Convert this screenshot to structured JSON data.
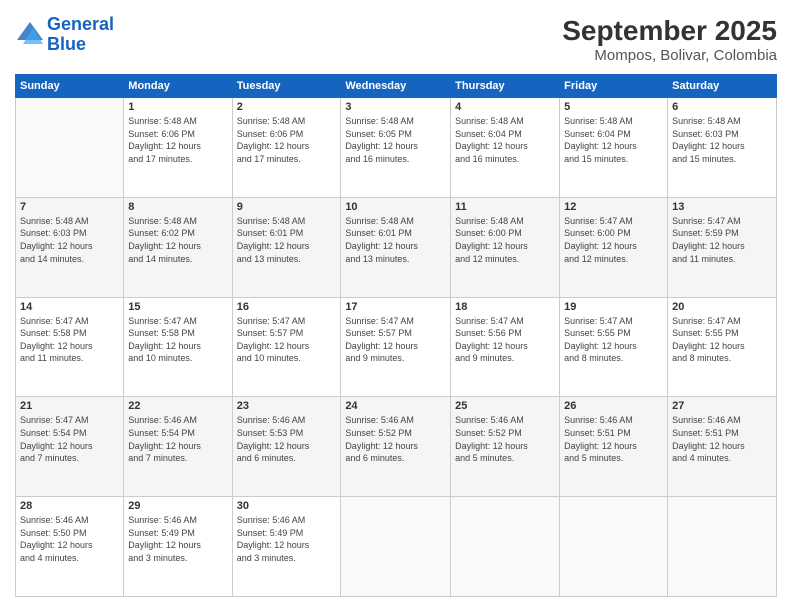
{
  "logo": {
    "line1": "General",
    "line2": "Blue"
  },
  "title": "September 2025",
  "subtitle": "Mompos, Bolivar, Colombia",
  "headers": [
    "Sunday",
    "Monday",
    "Tuesday",
    "Wednesday",
    "Thursday",
    "Friday",
    "Saturday"
  ],
  "weeks": [
    [
      {
        "day": "",
        "info": ""
      },
      {
        "day": "1",
        "info": "Sunrise: 5:48 AM\nSunset: 6:06 PM\nDaylight: 12 hours\nand 17 minutes."
      },
      {
        "day": "2",
        "info": "Sunrise: 5:48 AM\nSunset: 6:06 PM\nDaylight: 12 hours\nand 17 minutes."
      },
      {
        "day": "3",
        "info": "Sunrise: 5:48 AM\nSunset: 6:05 PM\nDaylight: 12 hours\nand 16 minutes."
      },
      {
        "day": "4",
        "info": "Sunrise: 5:48 AM\nSunset: 6:04 PM\nDaylight: 12 hours\nand 16 minutes."
      },
      {
        "day": "5",
        "info": "Sunrise: 5:48 AM\nSunset: 6:04 PM\nDaylight: 12 hours\nand 15 minutes."
      },
      {
        "day": "6",
        "info": "Sunrise: 5:48 AM\nSunset: 6:03 PM\nDaylight: 12 hours\nand 15 minutes."
      }
    ],
    [
      {
        "day": "7",
        "info": "Sunrise: 5:48 AM\nSunset: 6:03 PM\nDaylight: 12 hours\nand 14 minutes."
      },
      {
        "day": "8",
        "info": "Sunrise: 5:48 AM\nSunset: 6:02 PM\nDaylight: 12 hours\nand 14 minutes."
      },
      {
        "day": "9",
        "info": "Sunrise: 5:48 AM\nSunset: 6:01 PM\nDaylight: 12 hours\nand 13 minutes."
      },
      {
        "day": "10",
        "info": "Sunrise: 5:48 AM\nSunset: 6:01 PM\nDaylight: 12 hours\nand 13 minutes."
      },
      {
        "day": "11",
        "info": "Sunrise: 5:48 AM\nSunset: 6:00 PM\nDaylight: 12 hours\nand 12 minutes."
      },
      {
        "day": "12",
        "info": "Sunrise: 5:47 AM\nSunset: 6:00 PM\nDaylight: 12 hours\nand 12 minutes."
      },
      {
        "day": "13",
        "info": "Sunrise: 5:47 AM\nSunset: 5:59 PM\nDaylight: 12 hours\nand 11 minutes."
      }
    ],
    [
      {
        "day": "14",
        "info": "Sunrise: 5:47 AM\nSunset: 5:58 PM\nDaylight: 12 hours\nand 11 minutes."
      },
      {
        "day": "15",
        "info": "Sunrise: 5:47 AM\nSunset: 5:58 PM\nDaylight: 12 hours\nand 10 minutes."
      },
      {
        "day": "16",
        "info": "Sunrise: 5:47 AM\nSunset: 5:57 PM\nDaylight: 12 hours\nand 10 minutes."
      },
      {
        "day": "17",
        "info": "Sunrise: 5:47 AM\nSunset: 5:57 PM\nDaylight: 12 hours\nand 9 minutes."
      },
      {
        "day": "18",
        "info": "Sunrise: 5:47 AM\nSunset: 5:56 PM\nDaylight: 12 hours\nand 9 minutes."
      },
      {
        "day": "19",
        "info": "Sunrise: 5:47 AM\nSunset: 5:55 PM\nDaylight: 12 hours\nand 8 minutes."
      },
      {
        "day": "20",
        "info": "Sunrise: 5:47 AM\nSunset: 5:55 PM\nDaylight: 12 hours\nand 8 minutes."
      }
    ],
    [
      {
        "day": "21",
        "info": "Sunrise: 5:47 AM\nSunset: 5:54 PM\nDaylight: 12 hours\nand 7 minutes."
      },
      {
        "day": "22",
        "info": "Sunrise: 5:46 AM\nSunset: 5:54 PM\nDaylight: 12 hours\nand 7 minutes."
      },
      {
        "day": "23",
        "info": "Sunrise: 5:46 AM\nSunset: 5:53 PM\nDaylight: 12 hours\nand 6 minutes."
      },
      {
        "day": "24",
        "info": "Sunrise: 5:46 AM\nSunset: 5:52 PM\nDaylight: 12 hours\nand 6 minutes."
      },
      {
        "day": "25",
        "info": "Sunrise: 5:46 AM\nSunset: 5:52 PM\nDaylight: 12 hours\nand 5 minutes."
      },
      {
        "day": "26",
        "info": "Sunrise: 5:46 AM\nSunset: 5:51 PM\nDaylight: 12 hours\nand 5 minutes."
      },
      {
        "day": "27",
        "info": "Sunrise: 5:46 AM\nSunset: 5:51 PM\nDaylight: 12 hours\nand 4 minutes."
      }
    ],
    [
      {
        "day": "28",
        "info": "Sunrise: 5:46 AM\nSunset: 5:50 PM\nDaylight: 12 hours\nand 4 minutes."
      },
      {
        "day": "29",
        "info": "Sunrise: 5:46 AM\nSunset: 5:49 PM\nDaylight: 12 hours\nand 3 minutes."
      },
      {
        "day": "30",
        "info": "Sunrise: 5:46 AM\nSunset: 5:49 PM\nDaylight: 12 hours\nand 3 minutes."
      },
      {
        "day": "",
        "info": ""
      },
      {
        "day": "",
        "info": ""
      },
      {
        "day": "",
        "info": ""
      },
      {
        "day": "",
        "info": ""
      }
    ]
  ]
}
